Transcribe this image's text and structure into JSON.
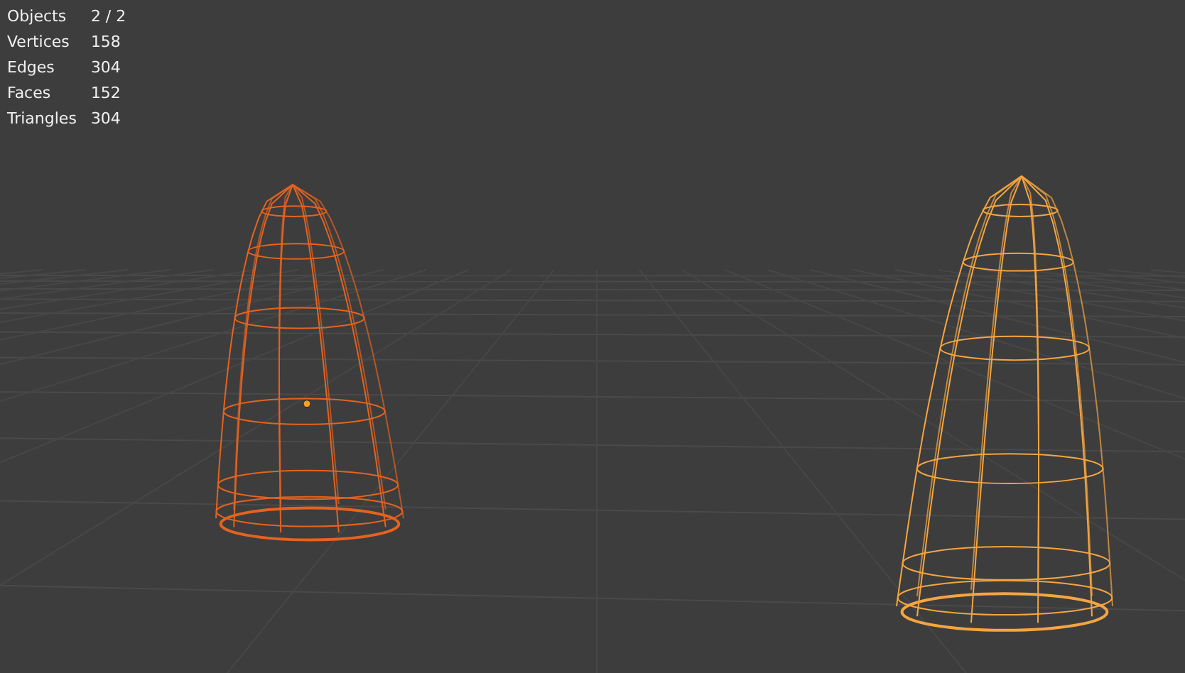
{
  "statistics": [
    {
      "label": "Objects",
      "value": "2 / 2"
    },
    {
      "label": "Vertices",
      "value": "158"
    },
    {
      "label": "Edges",
      "value": "304"
    },
    {
      "label": "Faces",
      "value": "152"
    },
    {
      "label": "Triangles",
      "value": "304"
    }
  ],
  "objects": [
    {
      "active": false
    },
    {
      "active": true
    }
  ]
}
